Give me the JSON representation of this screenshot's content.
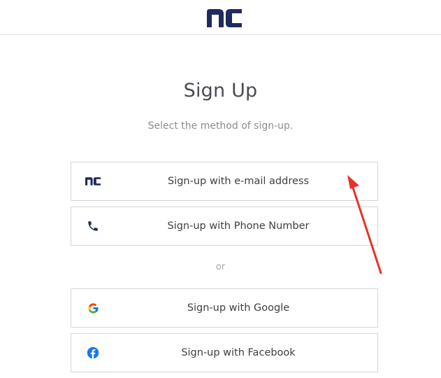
{
  "header": {
    "logo_icon": "nc-logo-icon",
    "brand_color": "#1e2b5e"
  },
  "main": {
    "title": "Sign Up",
    "subtitle": "Select the method of sign-up.",
    "or_label": "or"
  },
  "options": {
    "email": {
      "label": "Sign-up with e-mail address",
      "icon": "nc-logo-icon"
    },
    "phone": {
      "label": "Sign-up with Phone Number",
      "icon": "phone-icon"
    },
    "google": {
      "label": "Sign-up with Google",
      "icon": "google-icon"
    },
    "facebook": {
      "label": "Sign-up with Facebook",
      "icon": "facebook-icon",
      "color": "#1877f2"
    }
  },
  "annotation": {
    "icon": "red-arrow-annotation",
    "color": "#e8322b"
  }
}
